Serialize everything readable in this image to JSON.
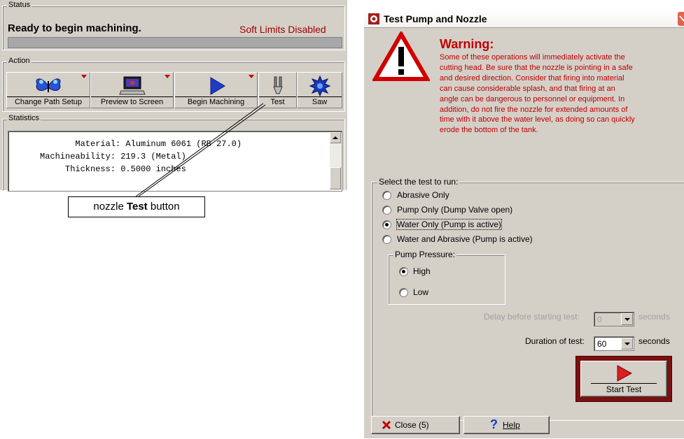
{
  "status": {
    "caption": "Status",
    "message": "Ready to begin machining.",
    "limits": "Soft Limits Disabled"
  },
  "action": {
    "caption": "Action",
    "buttons": [
      {
        "label": "Change Path Setup",
        "icon": "butterfly-icon"
      },
      {
        "label": "Preview to Screen",
        "icon": "laptop-icon"
      },
      {
        "label": "Begin Machining",
        "icon": "play-arrow-icon"
      },
      {
        "label": "Test",
        "icon": "nozzle-icon"
      },
      {
        "label": "Saw",
        "icon": "saw-blade-icon"
      }
    ]
  },
  "statistics": {
    "caption": "Statistics",
    "lines": [
      "       Material: Aluminum 6061 (RB 27.0)",
      "Machineability: 219.3 (Metal)",
      "     Thickness: 0.5000 inches"
    ]
  },
  "callout": {
    "text_plain": "nozzle ",
    "text_bold": "Test",
    "text_after": " button"
  },
  "dialog": {
    "title": "Test Pump and Nozzle",
    "warning_heading": "Warning:",
    "warning_lines": [
      "Some of these operations will immediately activate the",
      "cutting head. Be sure that the nozzle is pointing in a safe",
      "and desired direction.  Consider that firing into material",
      "can cause considerable splash, and that firing at an",
      "angle can be dangerous to personnel or equipment. In",
      "addition, do not fire the nozzle for extended amounts of",
      "time with it above the water level, as doing so can quickly",
      "erode the bottom of the tank."
    ],
    "test_group_caption": "Select the test to run:",
    "tests": [
      {
        "label": "Abrasive Only",
        "selected": false
      },
      {
        "label": "Pump Only (Dump Valve open)",
        "selected": false
      },
      {
        "label": "Water Only (Pump is active)",
        "selected": true
      },
      {
        "label": "Water and Abrasive (Pump is active)",
        "selected": false
      }
    ],
    "pressure_caption": "Pump Pressure:",
    "pressures": [
      {
        "label": "High",
        "selected": true
      },
      {
        "label": "Low",
        "selected": false
      }
    ],
    "delay_label": "Delay before starting test:",
    "delay_value": "0",
    "delay_unit": "seconds",
    "duration_label": "Duration of test:",
    "duration_value": "60",
    "duration_unit": "seconds",
    "start_label": "Start Test",
    "close_label": "Close (5)",
    "help_label": "Help",
    "colors": {
      "warning": "#c00000",
      "accent_border": "#7a1010"
    }
  }
}
